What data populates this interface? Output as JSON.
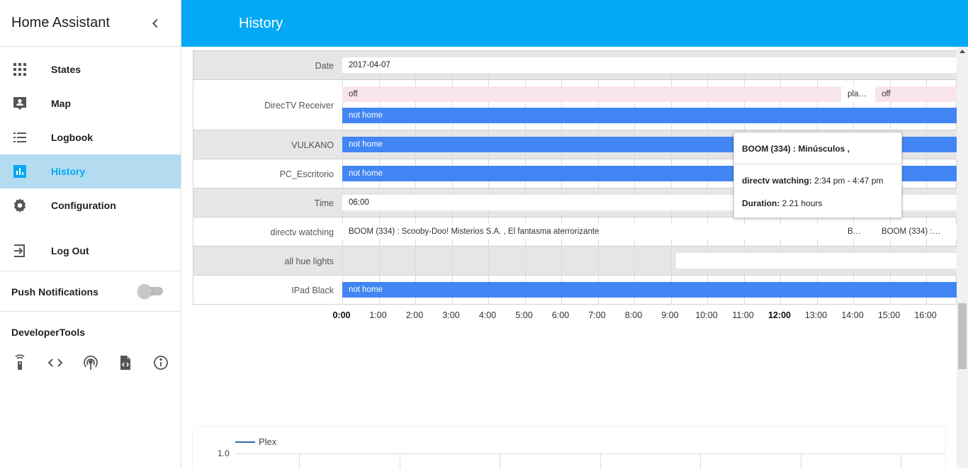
{
  "sidebar": {
    "title": "Home Assistant",
    "items": [
      {
        "label": "States",
        "icon": "grid-icon"
      },
      {
        "label": "Map",
        "icon": "account-box-icon"
      },
      {
        "label": "Logbook",
        "icon": "list-icon"
      },
      {
        "label": "History",
        "icon": "chart-icon",
        "active": true
      },
      {
        "label": "Configuration",
        "icon": "gear-icon"
      },
      {
        "label": "Log Out",
        "icon": "logout-icon"
      }
    ],
    "push_notifications": "Push Notifications",
    "push_notifications_enabled": false,
    "developer_tools": "DeveloperTools",
    "dev_icons": [
      "remote-icon",
      "code-icon",
      "broadcast-icon",
      "file-code-icon",
      "info-icon"
    ]
  },
  "header": {
    "title": "History"
  },
  "timeline": {
    "rows": [
      {
        "label": "Date",
        "bars": [
          {
            "text": "2017-04-07",
            "style": "white"
          }
        ]
      },
      {
        "label": "DirecTV Receiver",
        "bars": [
          {
            "text": "off",
            "style": "pink"
          },
          {
            "text": "pla…",
            "style": "plain"
          },
          {
            "text": "off",
            "style": "pink"
          },
          {
            "text": "not home",
            "style": "blue"
          }
        ]
      },
      {
        "label": "VULKANO",
        "bars": [
          {
            "text": "not home",
            "style": "blue"
          }
        ]
      },
      {
        "label": "PC_Escritorio",
        "bars": [
          {
            "text": "not home",
            "style": "blue"
          }
        ]
      },
      {
        "label": "Time",
        "bars": [
          {
            "text": "06:00",
            "style": "white"
          }
        ]
      },
      {
        "label": "directv watching",
        "bars": [
          {
            "text": "BOOM (334) : Scooby-Doo! Misterios S.A. , El fantasma aterrorizante",
            "style": "plain"
          },
          {
            "text": "B…",
            "style": "plain"
          },
          {
            "text": "BOOM (334) :…",
            "style": "plain"
          }
        ]
      },
      {
        "label": "all hue lights",
        "bars": [
          {
            "text": "",
            "style": "white"
          }
        ]
      },
      {
        "label": "IPad Black",
        "bars": [
          {
            "text": "not home",
            "style": "blue"
          }
        ]
      }
    ],
    "ticks": [
      "0:00",
      "1:00",
      "2:00",
      "3:00",
      "4:00",
      "5:00",
      "6:00",
      "7:00",
      "8:00",
      "9:00",
      "10:00",
      "11:00",
      "12:00",
      "13:00",
      "14:00",
      "15:00",
      "16:00"
    ],
    "bold_ticks": [
      "0:00",
      "12:00"
    ]
  },
  "tooltip": {
    "title": "BOOM (334) : Minúsculos ,",
    "entity_label": "directv watching:",
    "entity_value": "2:34 pm - 4:47 pm",
    "duration_label": "Duration:",
    "duration_value": "2.21 hours"
  },
  "plex_chart": {
    "legend": "Plex",
    "y_tick": "1.0",
    "series_color": "#3366aa"
  },
  "colors": {
    "header": "#03a9f4",
    "active_nav": "#b3dcf0",
    "bar_blue": "#4285f4",
    "bar_pink": "#f8e4ec"
  }
}
